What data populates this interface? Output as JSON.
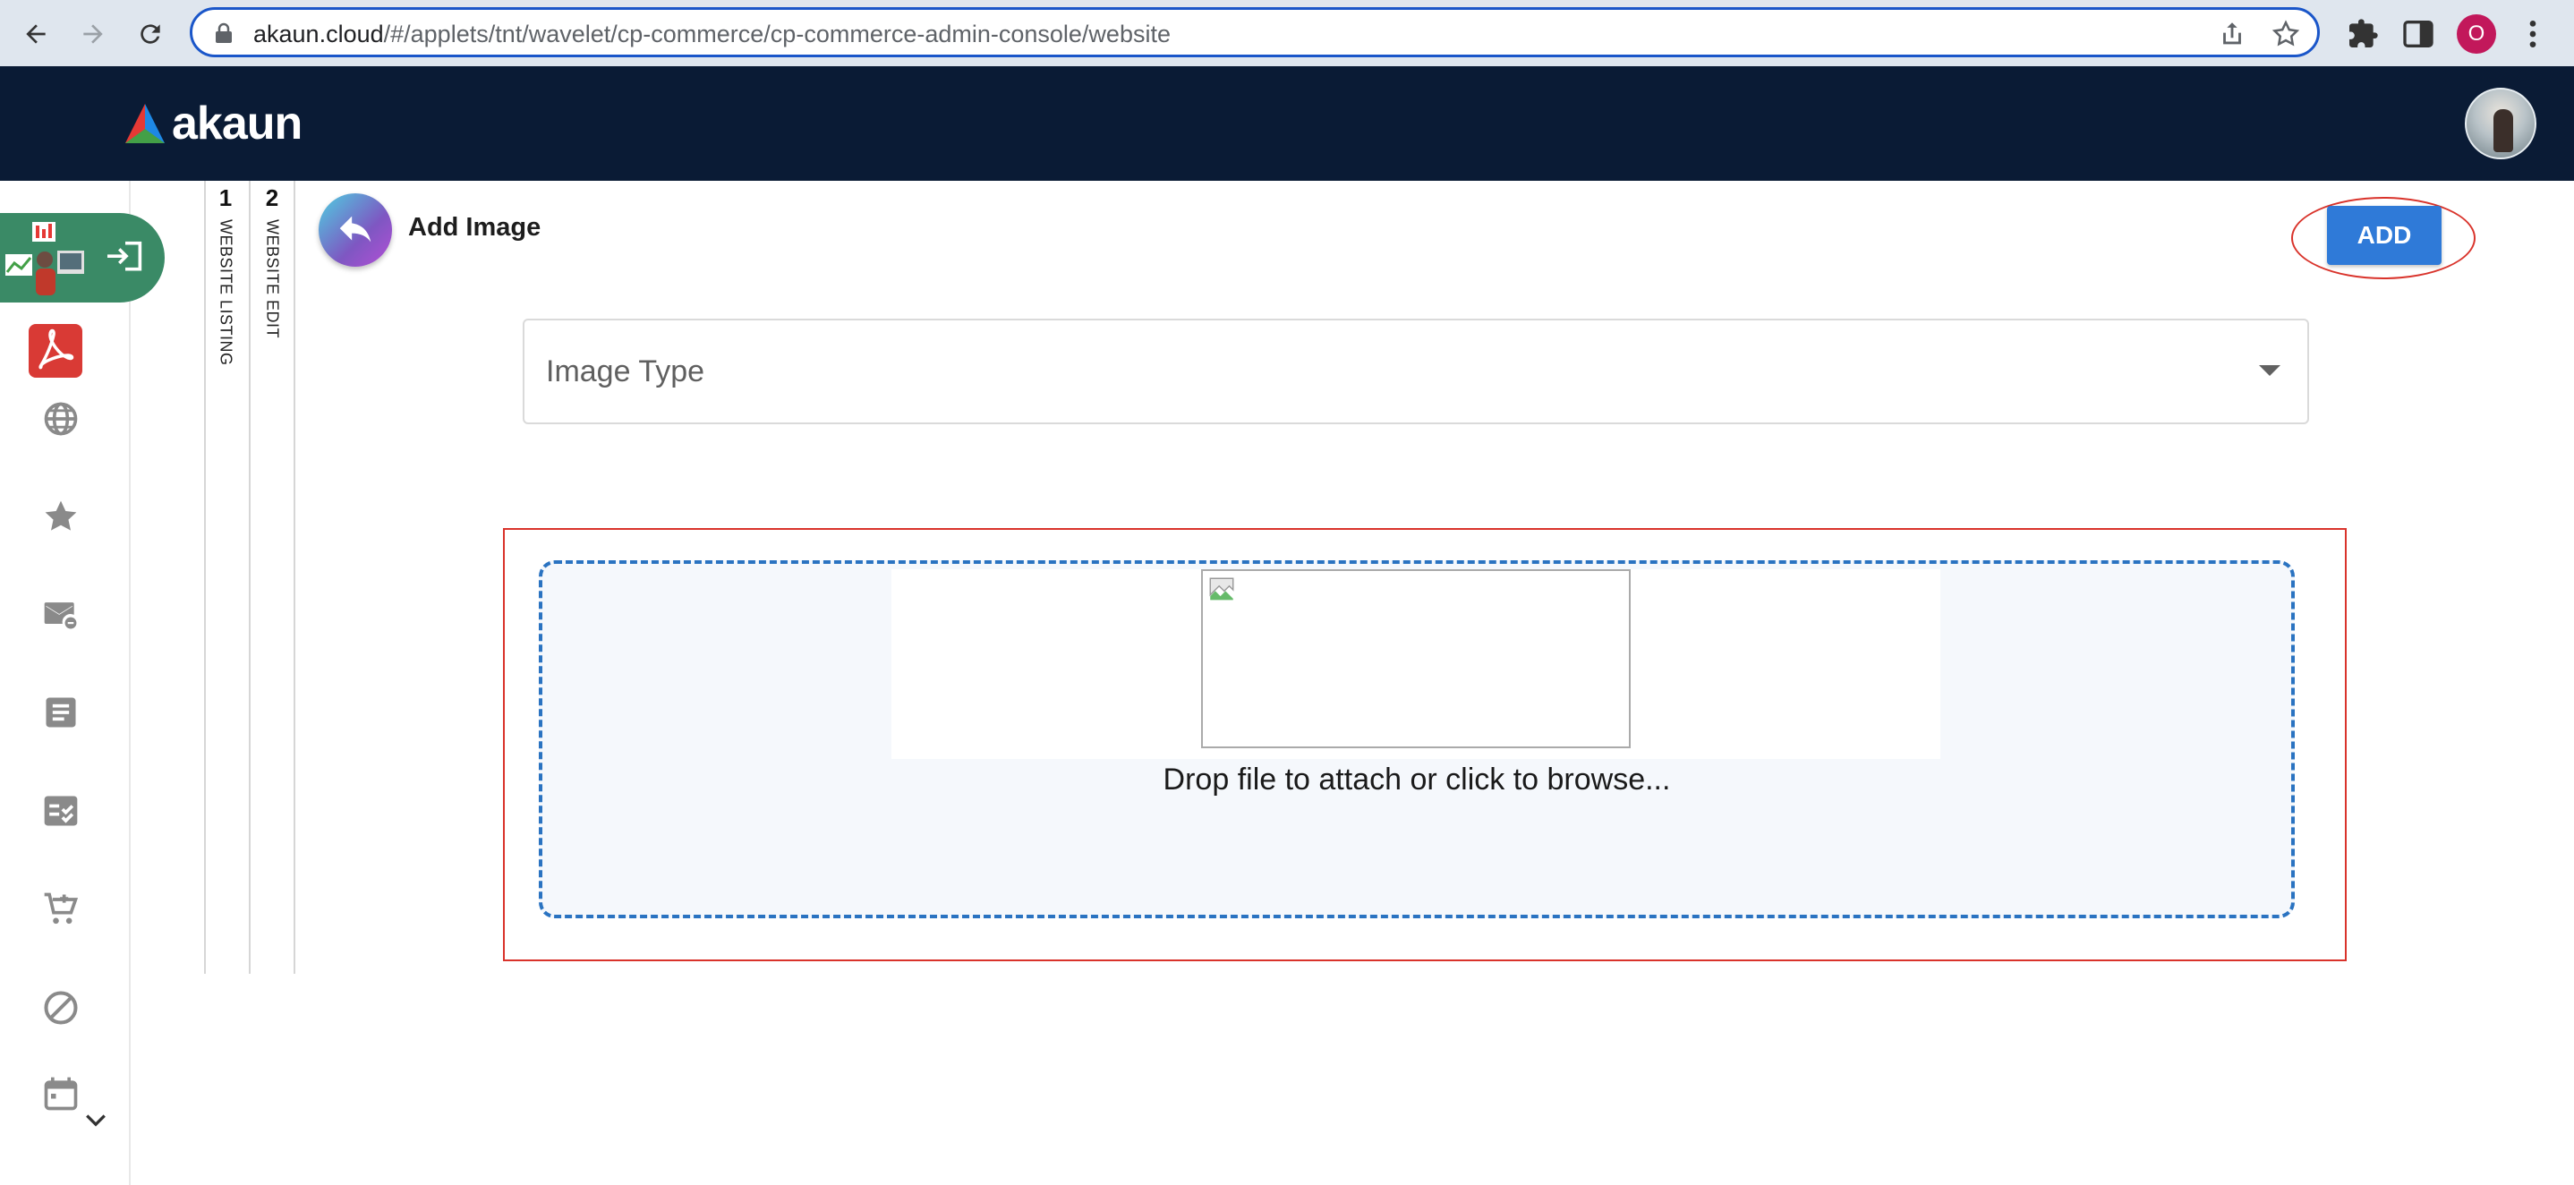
{
  "browser": {
    "url_host": "akaun.cloud",
    "url_path": "/#/applets/tnt/wavelet/cp-commerce/cp-commerce-admin-console/website",
    "profile_initial": "O"
  },
  "app": {
    "brand": "akaun"
  },
  "steps": [
    {
      "number": "1",
      "label": "WEBSITE LISTING"
    },
    {
      "number": "2",
      "label": "WEBSITE EDIT"
    }
  ],
  "page": {
    "title": "Add Image",
    "add_button": "ADD",
    "image_type_label": "Image Type",
    "drop_text": "Drop file to attach or click to browse..."
  },
  "colors": {
    "header_bg": "#0a1b35",
    "accent": "#2f7ad8",
    "highlight": "#d9332b",
    "sidebar_active": "#3a8a66"
  },
  "sidebar_icons": [
    "login-icon",
    "acrobat-icon",
    "globe-icon",
    "star-icon",
    "mail-icon",
    "document-icon",
    "checklist-icon",
    "cart-icon",
    "block-icon",
    "calendar-icon",
    "chevron-down-icon"
  ]
}
